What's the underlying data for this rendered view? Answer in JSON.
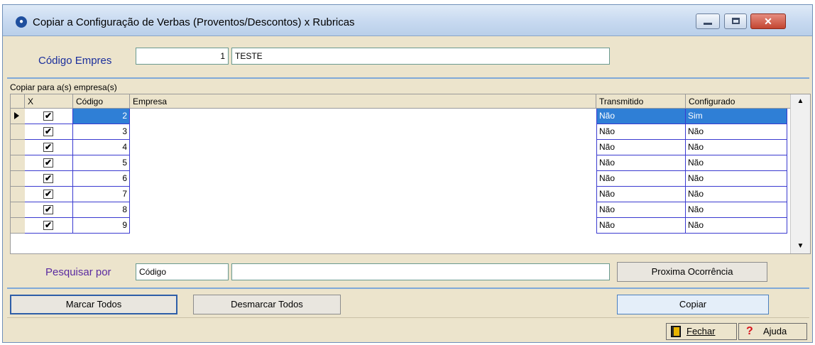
{
  "window": {
    "title": "Copiar a Configuração de Verbas (Proventos/Descontos) x Rubricas",
    "icon": "app-globe-icon"
  },
  "empresa": {
    "label": "Código Empres",
    "codigo": "1",
    "nome": "TESTE"
  },
  "grid": {
    "caption": "Copiar para a(s) empresa(s)",
    "columns": [
      "X",
      "Código",
      "Empresa",
      "Transmitido",
      "Configurado"
    ],
    "rows": [
      {
        "checked": "✔",
        "codigo": "2",
        "empresa": "",
        "transmitido": "Não",
        "configurado": "Sim",
        "selected": true
      },
      {
        "checked": "✔",
        "codigo": "3",
        "empresa": "",
        "transmitido": "Não",
        "configurado": "Não"
      },
      {
        "checked": "✔",
        "codigo": "4",
        "empresa": "",
        "transmitido": "Não",
        "configurado": "Não"
      },
      {
        "checked": "✔",
        "codigo": "5",
        "empresa": "",
        "transmitido": "Não",
        "configurado": "Não"
      },
      {
        "checked": "✔",
        "codigo": "6",
        "empresa": "",
        "transmitido": "Não",
        "configurado": "Não"
      },
      {
        "checked": "✔",
        "codigo": "7",
        "empresa": "",
        "transmitido": "Não",
        "configurado": "Não"
      },
      {
        "checked": "✔",
        "codigo": "8",
        "empresa": "",
        "transmitido": "Não",
        "configurado": "Não"
      },
      {
        "checked": "✔",
        "codigo": "9",
        "empresa": "",
        "transmitido": "Não",
        "configurado": "Não"
      }
    ]
  },
  "search": {
    "label": "Pesquisar por",
    "field": "Código",
    "value": "",
    "next_button": "Proxima Ocorrência"
  },
  "actions": {
    "mark_all": "Marcar Todos",
    "unmark_all": "Desmarcar Todos",
    "copy": "Copiar"
  },
  "footer": {
    "close": "Fechar",
    "help": "Ajuda"
  },
  "colors": {
    "form_bg": "#ece4cc",
    "selection": "#2f7fd6",
    "grid_lines": "#3a3ad0",
    "label_blue": "#1b2f9c",
    "label_purple": "#5a2aa0"
  }
}
